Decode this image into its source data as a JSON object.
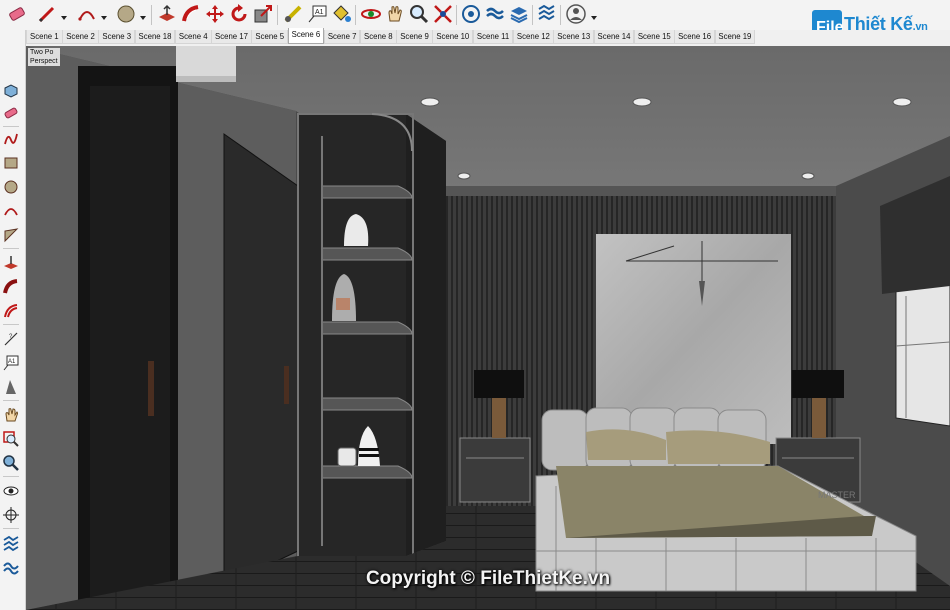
{
  "toolbar": {
    "tools": [
      {
        "icon": "eraser-icon"
      },
      {
        "icon": "pencil-line-icon"
      },
      {
        "icon": "arc-icon"
      },
      {
        "icon": "circle-shape-icon"
      },
      {
        "icon": "push-pull-icon"
      },
      {
        "icon": "follow-me-icon"
      },
      {
        "icon": "move-icon"
      },
      {
        "icon": "rotate-icon"
      },
      {
        "icon": "scale-icon"
      },
      {
        "icon": "tape-measure-icon"
      },
      {
        "icon": "text-label-icon"
      },
      {
        "icon": "paint-bucket-icon"
      },
      {
        "icon": "orbit-icon"
      },
      {
        "icon": "pan-hand-icon"
      },
      {
        "icon": "zoom-icon"
      },
      {
        "icon": "zoom-extents-icon"
      },
      {
        "icon": "components-icon"
      },
      {
        "icon": "materials-icon"
      },
      {
        "icon": "layers-icon"
      },
      {
        "icon": "styles-icon"
      },
      {
        "icon": "account-icon"
      }
    ]
  },
  "scenes": {
    "active": "Scene 6",
    "tabs": [
      "Scene 1",
      "Scene 2",
      "Scene 3",
      "Scene 18",
      "Scene 4",
      "Scene 17",
      "Scene 5",
      "Scene 6",
      "Scene 7",
      "Scene 8",
      "Scene 9",
      "Scene 10",
      "Scene 11",
      "Scene 12",
      "Scene 13",
      "Scene 14",
      "Scene 15",
      "Scene 16",
      "Scene 19"
    ]
  },
  "left_toolbar": {
    "tools": [
      {
        "icon": "select-box-icon"
      },
      {
        "icon": "eraser-icon"
      },
      {
        "icon": "freehand-icon"
      },
      {
        "icon": "rectangle-icon"
      },
      {
        "icon": "circle-icon"
      },
      {
        "icon": "arc-icon"
      },
      {
        "icon": "polygon-icon"
      },
      {
        "icon": "push-pull-icon"
      },
      {
        "icon": "follow-me-icon"
      },
      {
        "icon": "offset-icon"
      },
      {
        "icon": "dimension-icon"
      },
      {
        "icon": "text-icon"
      },
      {
        "icon": "section-plane-icon"
      },
      {
        "icon": "walk-icon"
      },
      {
        "icon": "zoom-window-icon"
      },
      {
        "icon": "zoom-icon"
      },
      {
        "icon": "look-around-icon"
      },
      {
        "icon": "position-camera-icon"
      },
      {
        "icon": "sandbox-icon"
      },
      {
        "icon": "sandbox-smoove-icon"
      }
    ]
  },
  "viewport": {
    "view_mode_line1": "Two Po",
    "view_mode_line2": "Perspect",
    "watermark": "Copyright © FileThietKe.vn",
    "wall_logo_text": "MASTER"
  },
  "logo": {
    "badge": "File",
    "name": "Thiết Kế",
    "suffix": ".vn"
  },
  "colors": {
    "brand_blue": "#1e88d0",
    "wall": "#5a5a5a",
    "floor": "#2f2f2f",
    "bed": "#c9c9c9",
    "bedding": "#8a8468"
  }
}
